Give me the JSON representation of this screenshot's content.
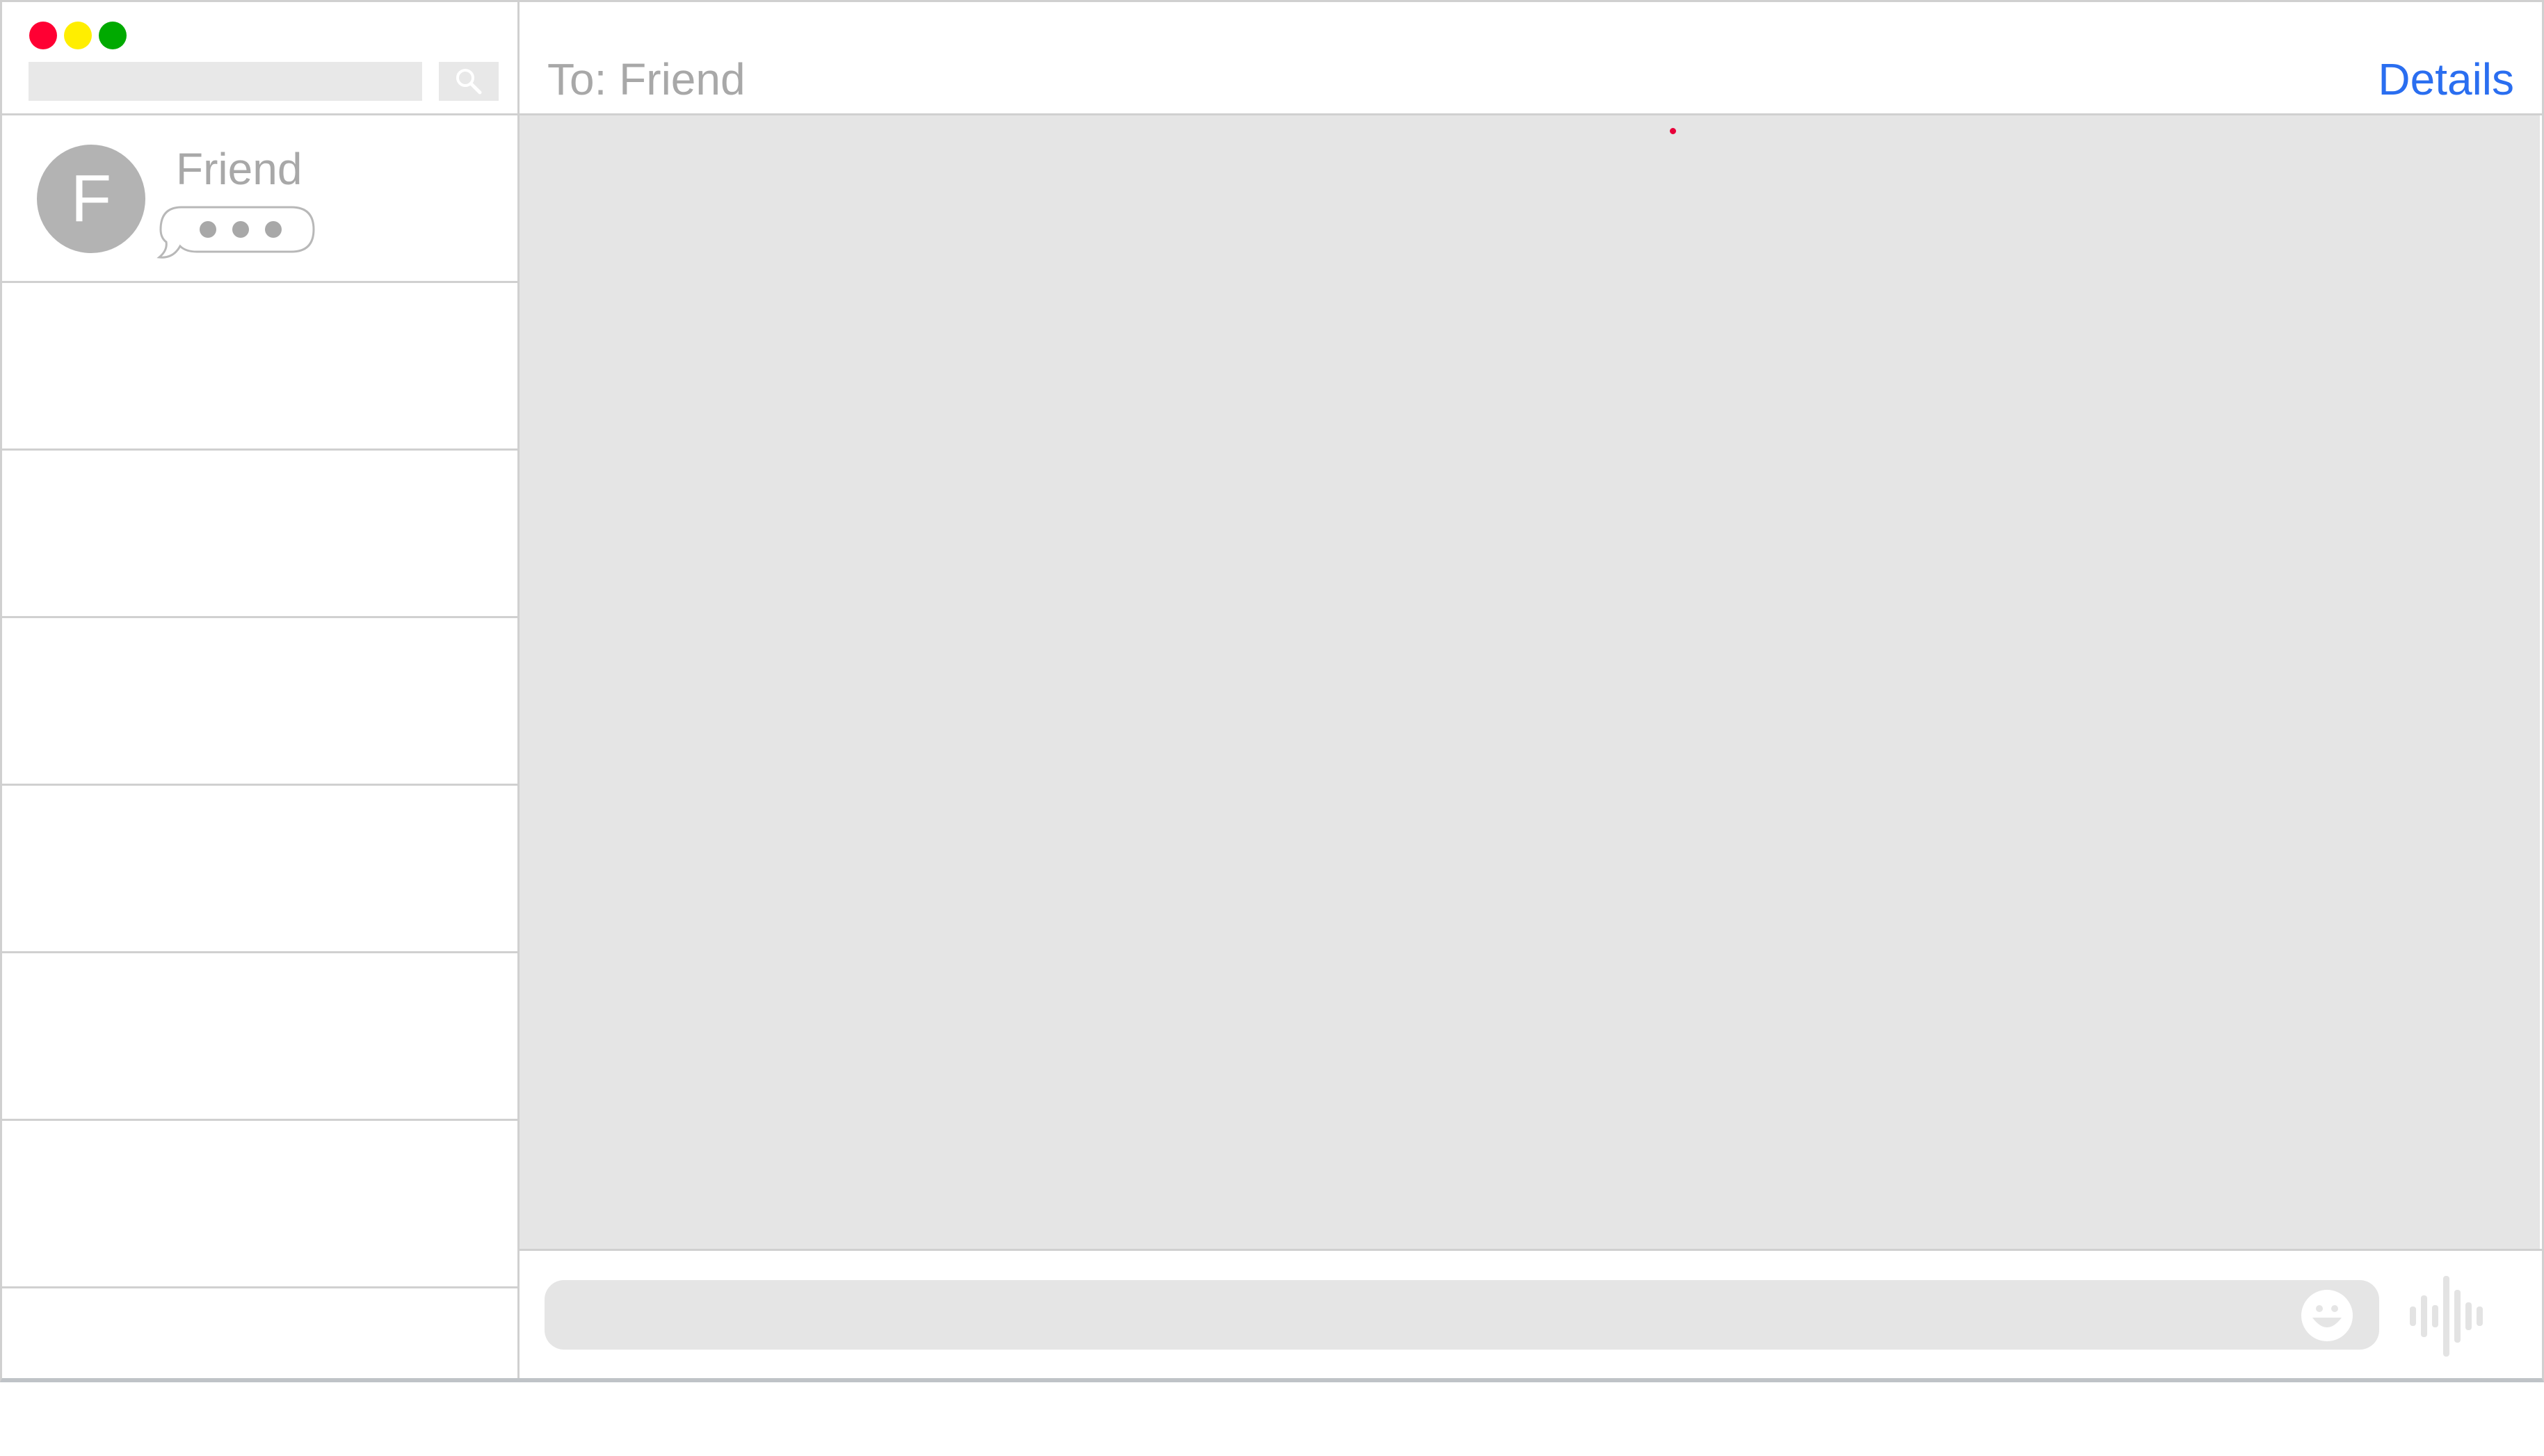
{
  "window": {
    "controls": [
      {
        "name": "close",
        "color": "#ff0033"
      },
      {
        "name": "minimize",
        "color": "#ffee00"
      },
      {
        "name": "zoom",
        "color": "#00aa00"
      }
    ]
  },
  "sidebar": {
    "search": {
      "value": "",
      "placeholder": "",
      "icon": "search-icon"
    },
    "conversations": [
      {
        "avatar_initial": "F",
        "name": "Friend",
        "status": "typing-indicator-icon"
      },
      {},
      {},
      {},
      {},
      {},
      {},
      {}
    ]
  },
  "header": {
    "to_label": "To: Friend",
    "details_label": "Details"
  },
  "composer": {
    "input_value": "",
    "input_placeholder": "",
    "emoji_icon": "smiley-face-icon",
    "audio_icon": "audio-waveform-icon"
  },
  "colors": {
    "accent": "#2a6ef0",
    "muted_text": "#a8a8a8",
    "transcript_bg": "#e5e5e5"
  }
}
